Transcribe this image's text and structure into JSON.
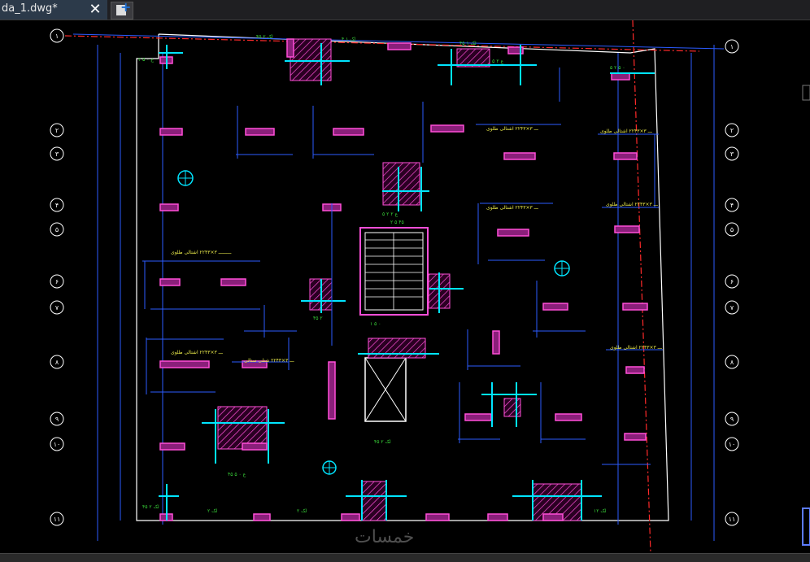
{
  "tab": {
    "title": "da_1.dwg*",
    "close_glyph": "✕"
  },
  "new_tab": {
    "icon": "new-drawing-icon"
  },
  "grid_bubbles_left": [
    "۱",
    "۲",
    "۳",
    "۴",
    "۵",
    "۶",
    "۷",
    "۸",
    "۹",
    "۱۰",
    "۱۱",
    "۱۲"
  ],
  "grid_bubbles_right": [
    "۱",
    "۲",
    "۳",
    "۴",
    "۵",
    "۶",
    "۷",
    "۸",
    "۹",
    "۱۰",
    "۱۱",
    "۱۲"
  ],
  "watermark": "خمسات",
  "colors": {
    "background": "#000000",
    "outline": "#ffffff",
    "dimension": "#2b5bff",
    "text": "#e8e84a",
    "green_text": "#39d339",
    "cyan": "#00e5ff",
    "column": "#ff4fd8",
    "property_line": "#ff2a2a"
  }
}
